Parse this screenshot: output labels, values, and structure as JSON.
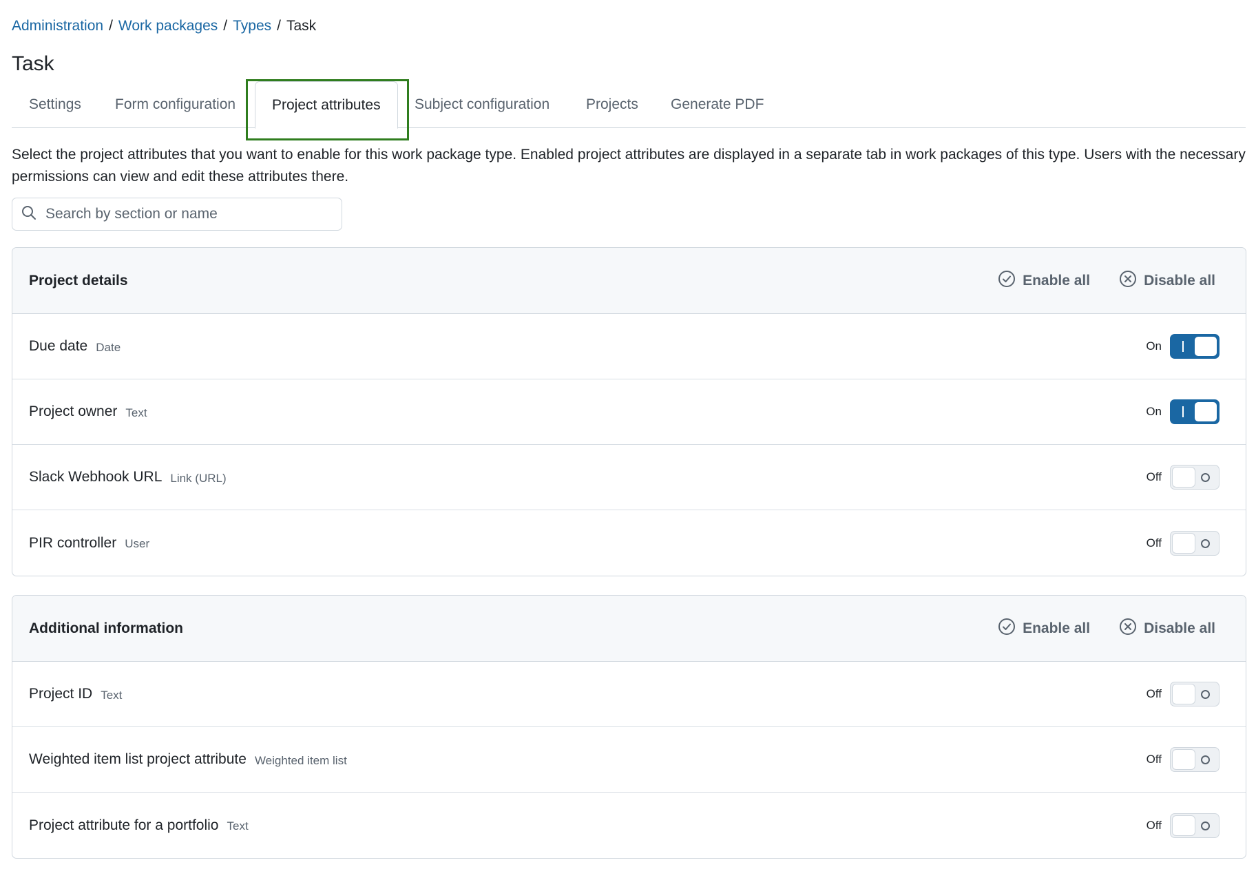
{
  "breadcrumb": {
    "items": [
      "Administration",
      "Work packages",
      "Types"
    ],
    "current": "Task"
  },
  "page_title": "Task",
  "tabs": [
    {
      "label": "Settings",
      "active": false
    },
    {
      "label": "Form configuration",
      "active": false
    },
    {
      "label": "Project attributes",
      "active": true
    },
    {
      "label": "Subject configuration",
      "active": false
    },
    {
      "label": "Projects",
      "active": false
    },
    {
      "label": "Generate PDF",
      "active": false
    }
  ],
  "description": "Select the project attributes that you want to enable for this work package type. Enabled project attributes are displayed in a separate tab in work packages of this type. Users with the necessary permissions can view and edit these attributes there.",
  "search": {
    "placeholder": "Search by section or name",
    "value": ""
  },
  "buttons": {
    "enable_all": "Enable all",
    "disable_all": "Disable all"
  },
  "sections": [
    {
      "title": "Project details",
      "rows": [
        {
          "name": "Due date",
          "type": "Date",
          "state": "On"
        },
        {
          "name": "Project owner",
          "type": "Text",
          "state": "On"
        },
        {
          "name": "Slack Webhook URL",
          "type": "Link (URL)",
          "state": "Off"
        },
        {
          "name": "PIR controller",
          "type": "User",
          "state": "Off"
        }
      ]
    },
    {
      "title": "Additional information",
      "rows": [
        {
          "name": "Project ID",
          "type": "Text",
          "state": "Off"
        },
        {
          "name": "Weighted item list project attribute",
          "type": "Weighted item list",
          "state": "Off"
        },
        {
          "name": "Project attribute for a portfolio",
          "type": "Text",
          "state": "Off"
        }
      ]
    }
  ],
  "colors": {
    "accent": "#1a67a3",
    "highlight": "#2f7d1e"
  }
}
